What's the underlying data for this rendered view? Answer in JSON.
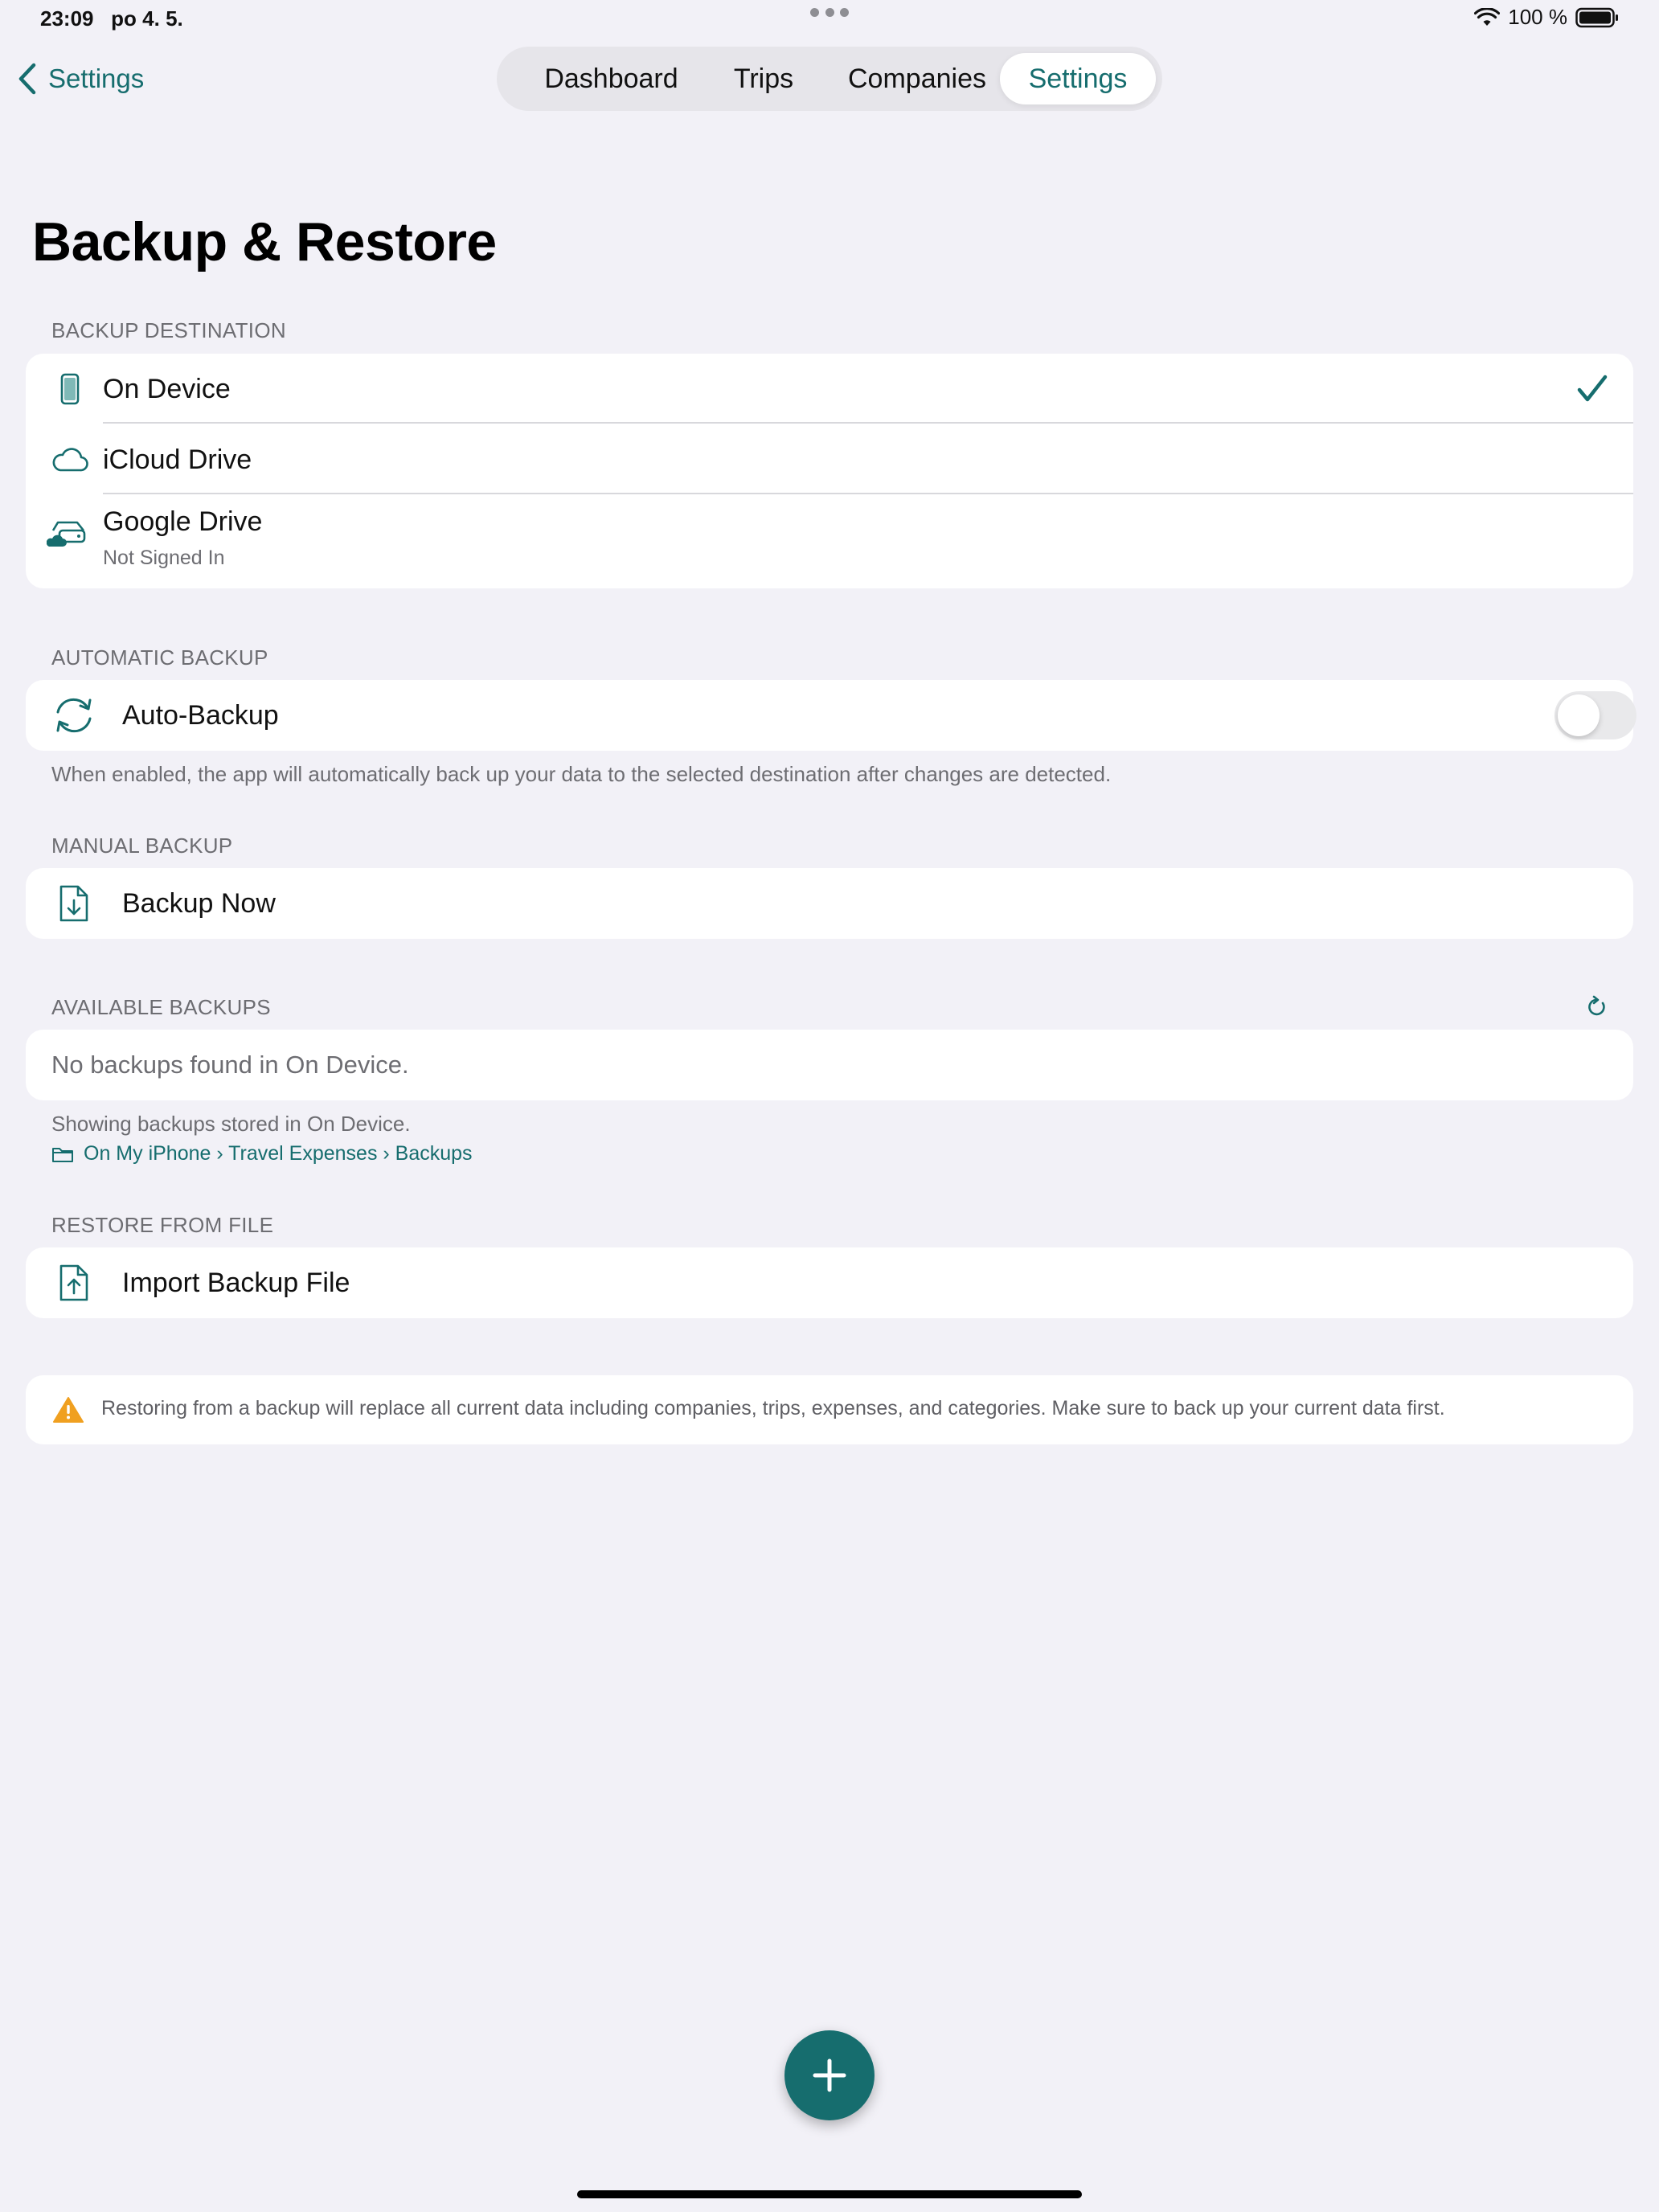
{
  "status_bar": {
    "time": "23:09",
    "date": "po 4. 5.",
    "battery": "100 %"
  },
  "nav": {
    "back_label": "Settings",
    "tabs": [
      {
        "label": "Dashboard",
        "active": false
      },
      {
        "label": "Trips",
        "active": false
      },
      {
        "label": "Companies",
        "active": false
      },
      {
        "label": "Settings",
        "active": true
      }
    ]
  },
  "page": {
    "title": "Backup & Restore"
  },
  "backup_destination": {
    "header": "BACKUP DESTINATION",
    "items": [
      {
        "label": "On Device",
        "icon": "phone-icon",
        "selected": true
      },
      {
        "label": "iCloud Drive",
        "icon": "cloud-icon",
        "selected": false
      },
      {
        "label": "Google Drive",
        "subtitle": "Not Signed In",
        "icon": "cloud-drive-icon",
        "selected": false
      }
    ]
  },
  "automatic_backup": {
    "header": "AUTOMATIC BACKUP",
    "label": "Auto-Backup",
    "enabled": false,
    "footer": "When enabled, the app will automatically back up your data to the selected destination after changes are detected."
  },
  "manual_backup": {
    "header": "MANUAL BACKUP",
    "button_label": "Backup Now"
  },
  "available_backups": {
    "header": "AVAILABLE BACKUPS",
    "empty_message": "No backups found in On Device.",
    "footer": "Showing backups stored in On Device.",
    "path": "On My iPhone › Travel Expenses › Backups"
  },
  "restore": {
    "header": "RESTORE FROM FILE",
    "button_label": "Import Backup File"
  },
  "warning": {
    "text": "Restoring from a backup will replace all current data including companies, trips, expenses, and categories. Make sure to back up your current data first."
  },
  "colors": {
    "accent": "#166d6e",
    "background": "#f2f1f7",
    "card": "#ffffff",
    "secondary_text": "#6d6d72",
    "warning": "#f0a020"
  }
}
